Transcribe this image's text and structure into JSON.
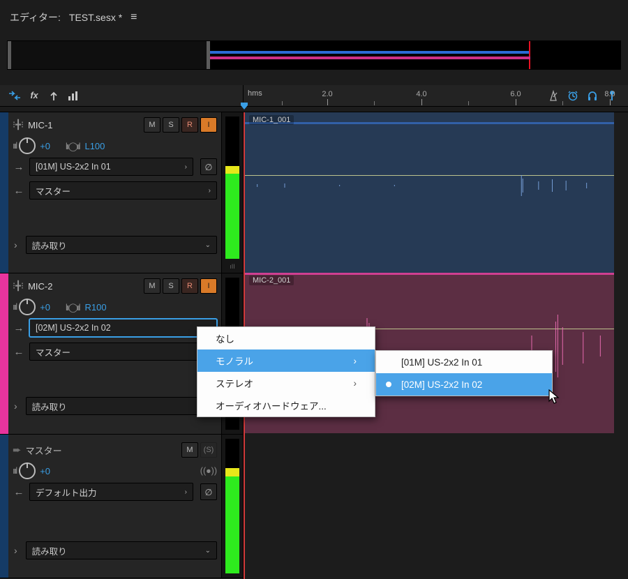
{
  "header": {
    "editor_prefix": "エディター:",
    "filename": "TEST.sesx *"
  },
  "ruler": {
    "unit": "hms",
    "ticks": [
      "2.0",
      "4.0",
      "6.0",
      "8.0"
    ]
  },
  "vu_midscale_label": "ıII",
  "tracks": [
    {
      "id": "mic1",
      "name": "MIC-1",
      "buttons": {
        "m": "M",
        "s": "S",
        "r": "R",
        "i": "I"
      },
      "volume": "+0",
      "pan": "L100",
      "input": "[01M] US-2x2 In 01",
      "output": "マスター",
      "readmode": "読み取り",
      "clip_label": "MIC-1_001"
    },
    {
      "id": "mic2",
      "name": "MIC-2",
      "buttons": {
        "m": "M",
        "s": "S",
        "r": "R",
        "i": "I"
      },
      "volume": "+0",
      "pan": "R100",
      "input": "[02M] US-2x2 In 02",
      "output": "マスター",
      "readmode": "読み取り",
      "clip_label": "MIC-2_001"
    },
    {
      "id": "master",
      "name": "マスター",
      "buttons": {
        "m": "M",
        "s": "(S)"
      },
      "volume": "+0",
      "output": "デフォルト出力",
      "readmode": "読み取り"
    }
  ],
  "context_menu": {
    "items": [
      {
        "label": "なし",
        "submenu": false
      },
      {
        "label": "モノラル",
        "submenu": true,
        "highlight": true
      },
      {
        "label": "ステレオ",
        "submenu": true
      },
      {
        "label": "オーディオハードウェア...",
        "submenu": false
      }
    ],
    "sub_items": [
      {
        "label": "[01M] US-2x2 In 01",
        "selected": false
      },
      {
        "label": "[02M] US-2x2 In 02",
        "selected": true,
        "highlight": true
      }
    ]
  }
}
